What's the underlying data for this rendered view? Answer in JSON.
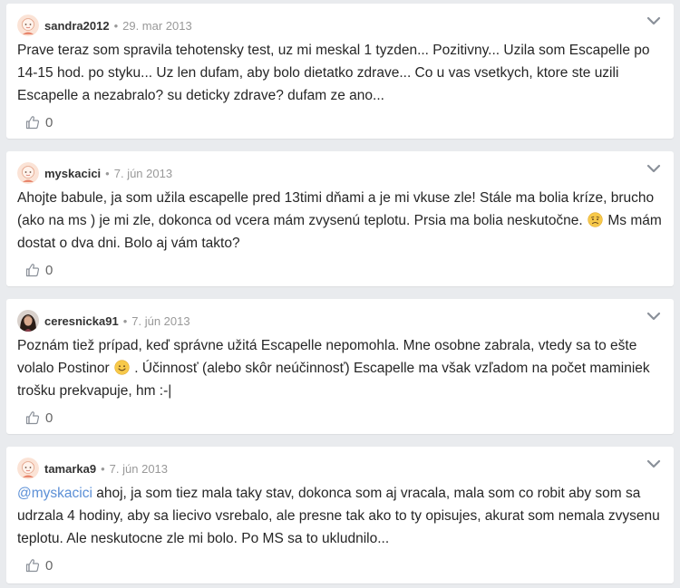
{
  "comments": [
    {
      "author": "sandra2012",
      "separator": "•",
      "date": "29. mar 2013",
      "text": "Prave teraz som spravila tehotensky test, uz mi meskal 1 tyzden... Pozitivny... Uzila som Escapelle po 14-15 hod. po styku... Uz len dufam, aby bolo dietatko zdrave... Co u vas vsetkych, ktore ste uzili Escapelle a nezabralo? su deticky zdrave? dufam ze ano...",
      "likes": "0"
    },
    {
      "author": "myskacici",
      "separator": "•",
      "date": "7. jún 2013",
      "text_before": "Ahojte babule, ja som užila escapelle pred 13timi dňami a je mi vkuse zle! Stále ma bolia kríze, brucho (ako na ms ) je mi zle, dokonca od vcera mám zvysenú teplotu. Prsia ma bolia neskutočne.",
      "text_after": "Ms mám dostat o dva dni. Bolo aj vám takto?",
      "emoji": "worried-face-emoji",
      "likes": "0"
    },
    {
      "author": "ceresnicka91",
      "separator": "•",
      "date": "7. jún 2013",
      "text_before": "Poznám tiež prípad, keď správne užitá Escapelle nepomohla. Mne osobne zabrala, vtedy sa to ešte volalo Postinor",
      "text_after": ". Účinnosť (alebo skôr neúčinnosť) Escapelle ma však vzľadom na počet maminiek trošku prekvapuje, hm :-|",
      "emoji": "smiling-face-emoji",
      "likes": "0"
    },
    {
      "author": "tamarka9",
      "separator": "•",
      "date": "7. jún 2013",
      "mention": "@myskacici",
      "text_after": " ahoj, ja som tiez mala taky stav, dokonca som aj vracala, mala som co robit aby som sa udrzala 4 hodiny, aby sa liecivo vsrebalo, ale presne tak ako to ty opisujes, akurat som nemala zvysenu teplotu. Ale neskutocne zle mi bolo. Po MS sa to ukludnilo...",
      "likes": "0"
    }
  ],
  "icons": {
    "chevron": "chevron-down-icon",
    "like": "thumbs-up-icon",
    "avatar": "avatar"
  },
  "colors": {
    "background": "#e9ebee",
    "card": "#ffffff",
    "mention": "#5b8fd6",
    "meta": "#999999",
    "text": "#262626"
  }
}
